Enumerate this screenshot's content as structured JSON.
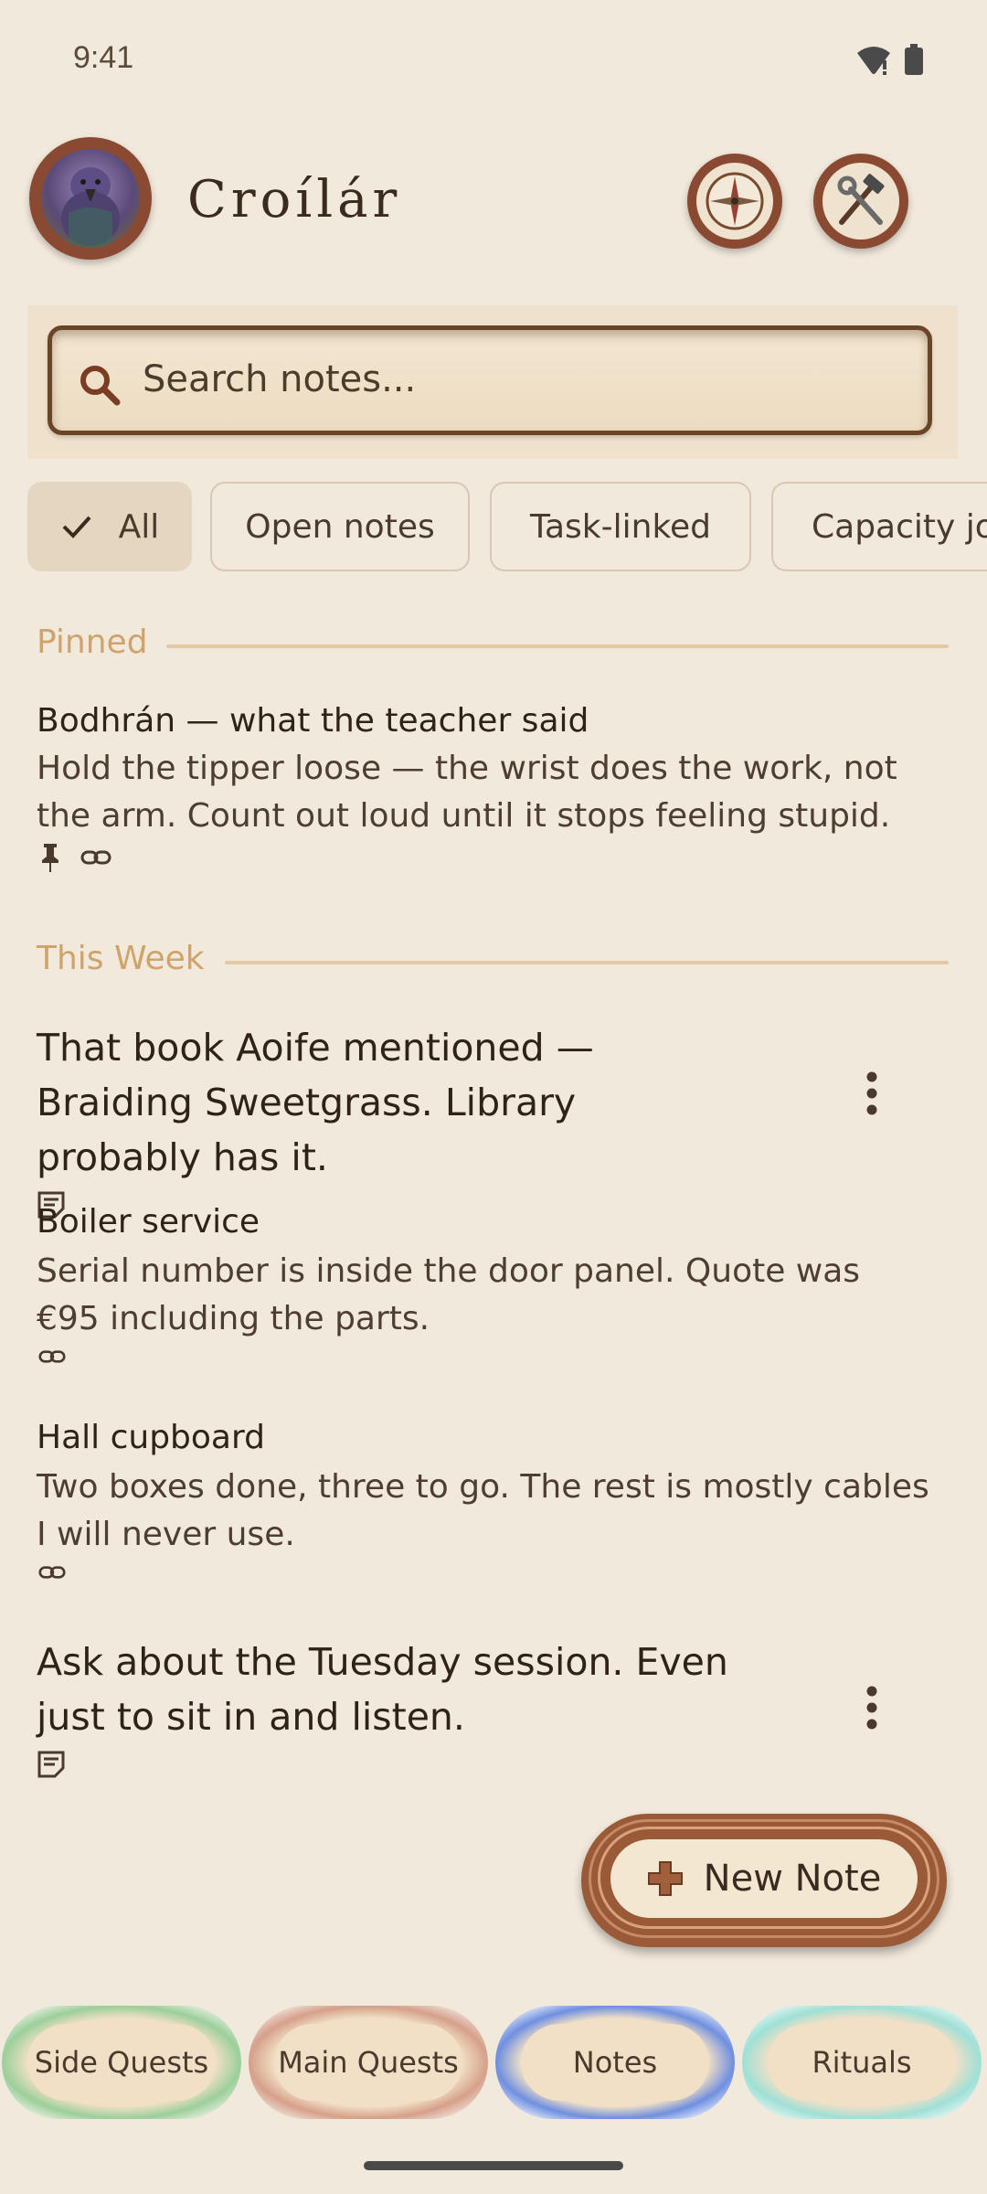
{
  "status_bar": {
    "time": "9:41"
  },
  "header": {
    "app_title": "Croílár"
  },
  "search": {
    "placeholder": "Search notes..."
  },
  "filters": [
    {
      "label": "All",
      "selected": true
    },
    {
      "label": "Open notes",
      "selected": false
    },
    {
      "label": "Task-linked",
      "selected": false
    },
    {
      "label": "Capacity jou",
      "selected": false
    }
  ],
  "sections": {
    "pinned": {
      "label": "Pinned",
      "notes": [
        {
          "title": "Bodhrán — what the teacher said",
          "body": "Hold the tipper loose — the wrist does the work, not the arm. Count out loud until it stops feeling stupid.",
          "icons": [
            "pin-icon",
            "link-icon"
          ]
        }
      ]
    },
    "this_week": {
      "label": "This Week",
      "notes": [
        {
          "title": "That book Aoife mentioned — Braiding Sweetgrass. Library probably has it.",
          "icons": [
            "note-icon"
          ]
        },
        {
          "title": "Boiler service",
          "body": "Serial number is inside the door panel. Quote was €95 including the parts.",
          "icons": [
            "link-icon"
          ]
        },
        {
          "title": "Hall cupboard",
          "body": "Two boxes done, three to go. The rest is mostly cables I will never use.",
          "icons": [
            "link-icon"
          ]
        },
        {
          "title": "Ask about the Tuesday session. Even just to sit in and listen.",
          "icons": [
            "note-icon"
          ]
        }
      ]
    }
  },
  "fab": {
    "label": "New Note"
  },
  "bottom_nav": [
    {
      "label": "Side Quests",
      "ring_color": "#9ccf9a"
    },
    {
      "label": "Main Quests",
      "ring_color": "#d6a08a"
    },
    {
      "label": "Notes",
      "ring_color": "#6f8fe0",
      "selected": true
    },
    {
      "label": "Rituals",
      "ring_color": "#9fe0d6"
    }
  ],
  "colors": {
    "background": "#f2e9dd",
    "section_accent": "#cfa36a",
    "wood": "#8a4a32"
  }
}
